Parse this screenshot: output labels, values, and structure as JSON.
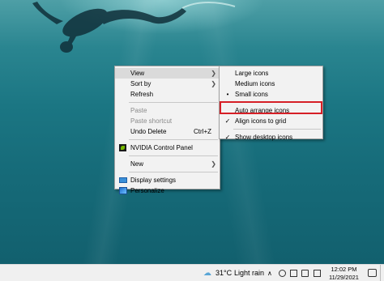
{
  "context_menu": {
    "items": [
      {
        "label": "View",
        "has_submenu": true,
        "hover": true
      },
      {
        "label": "Sort by",
        "has_submenu": true
      },
      {
        "label": "Refresh"
      },
      {
        "label": "Paste",
        "disabled": true
      },
      {
        "label": "Paste shortcut",
        "disabled": true
      },
      {
        "label": "Undo Delete",
        "shortcut": "Ctrl+Z"
      },
      {
        "label": "NVIDIA Control Panel",
        "icon": "nvidia-icon"
      },
      {
        "label": "New",
        "has_submenu": true
      },
      {
        "label": "Display settings",
        "icon": "display-settings-icon"
      },
      {
        "label": "Personalize",
        "icon": "personalize-icon"
      }
    ]
  },
  "view_submenu": {
    "items": [
      {
        "label": "Large icons"
      },
      {
        "label": "Medium icons"
      },
      {
        "label": "Small icons",
        "marker": "•"
      },
      {
        "label": "Auto arrange icons",
        "highlighted": true
      },
      {
        "label": "Align icons to grid",
        "marker": "✓"
      },
      {
        "label": "Show desktop icons",
        "marker": "✓"
      }
    ]
  },
  "taskbar": {
    "weather_icon": "cloud-rain-icon",
    "temperature": "31°C",
    "condition": "Light rain",
    "time": "12:02 PM",
    "date": "11/29/2021"
  },
  "colors": {
    "highlight_border": "#d61f26",
    "menu_background": "#f2f2f2",
    "taskbar_background": "#f0f0f0"
  }
}
